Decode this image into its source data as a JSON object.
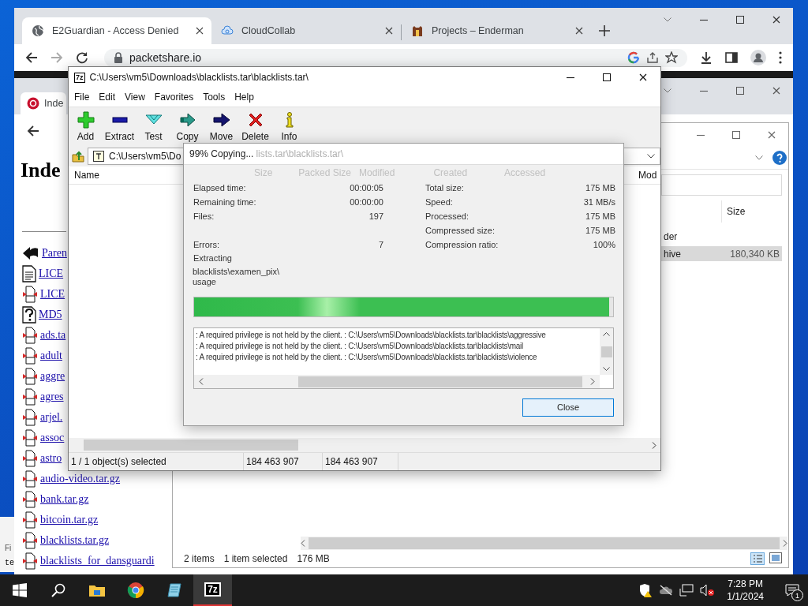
{
  "browser": {
    "tabs": [
      {
        "title": "E2Guardian - Access Denied",
        "selected": true
      },
      {
        "title": "CloudCollab",
        "selected": false
      },
      {
        "title": "Projects – Enderman",
        "selected": false
      }
    ],
    "url": "packetshare.io",
    "page": {
      "tab_title": "Inde",
      "heading": "Inde",
      "links": [
        {
          "text": "Paren",
          "kind": "back"
        },
        {
          "text": "LICE",
          "kind": "text"
        },
        {
          "text": "LICE",
          "kind": "archive"
        },
        {
          "text": "MD5",
          "kind": "unknown"
        },
        {
          "text": "ads.ta",
          "kind": "archive"
        },
        {
          "text": "adult",
          "kind": "archive"
        },
        {
          "text": "aggre",
          "kind": "archive"
        },
        {
          "text": "agres",
          "kind": "archive"
        },
        {
          "text": "arjel.",
          "kind": "archive"
        },
        {
          "text": "assoc",
          "kind": "archive"
        },
        {
          "text": "astro",
          "kind": "archive"
        },
        {
          "text": "audio-video.tar.gz",
          "kind": "archive"
        },
        {
          "text": "bank.tar.gz",
          "kind": "archive"
        },
        {
          "text": "bitcoin.tar.gz",
          "kind": "archive"
        },
        {
          "text": "blacklists.tar.gz",
          "kind": "archive"
        },
        {
          "text": "blacklists_for_dansguardi",
          "kind": "archive"
        }
      ]
    }
  },
  "explorer": {
    "column": "Size",
    "rows": [
      {
        "name": "der",
        "selected": false
      },
      {
        "name": "hive",
        "size": "180,340 KB",
        "selected": true
      }
    ],
    "status": {
      "items": "2 items",
      "selected": "1 item selected",
      "size": "176 MB"
    }
  },
  "sevenzip": {
    "logo": "7z",
    "title": "C:\\Users\\vm5\\Downloads\\blacklists.tar\\blacklists.tar\\",
    "menu": [
      "File",
      "Edit",
      "View",
      "Favorites",
      "Tools",
      "Help"
    ],
    "toolbar": [
      {
        "label": "Add",
        "kind": "add"
      },
      {
        "label": "Extract",
        "kind": "extract"
      },
      {
        "label": "Test",
        "kind": "test"
      },
      {
        "label": "Copy",
        "kind": "copy"
      },
      {
        "label": "Move",
        "kind": "move"
      },
      {
        "label": "Delete",
        "kind": "delete"
      },
      {
        "label": "Info",
        "kind": "info"
      }
    ],
    "path": "C:\\Users\\vm5\\Do",
    "columns": [
      "Name",
      "Mod"
    ],
    "status": [
      "1 / 1 object(s) selected",
      "184 463 907",
      "184 463 907"
    ]
  },
  "progress": {
    "title": "99% Copying...",
    "title_behind": "lists.tar\\blacklists.tar\\",
    "columns_behind": [
      "Size",
      "Packed Size",
      "Modified",
      "Created",
      "Accessed"
    ],
    "stats_left": [
      {
        "label": "Elapsed time:",
        "value": "00:00:05"
      },
      {
        "label": "Remaining time:",
        "value": "00:00:00"
      },
      {
        "label": "Files:",
        "value": "197"
      },
      {
        "label": "Errors:",
        "value": "7"
      }
    ],
    "stats_right": [
      {
        "label": "Total size:",
        "value": "175 MB"
      },
      {
        "label": "Speed:",
        "value": "31 MB/s"
      },
      {
        "label": "Processed:",
        "value": "175 MB"
      },
      {
        "label": "Compressed size:",
        "value": "175 MB"
      },
      {
        "label": "Compression ratio:",
        "value": "100%"
      }
    ],
    "operation": "Extracting",
    "current_file": "blacklists\\examen_pix\\usage",
    "level": 0.99,
    "log": [
      ": A required privilege is not held by the client. : C:\\Users\\vm5\\Downloads\\blacklists.tar\\blacklists\\aggressive",
      ": A required privilege is not held by the client. : C:\\Users\\vm5\\Downloads\\blacklists.tar\\blacklists\\mail",
      ": A required privilege is not held by the client. : C:\\Users\\vm5\\Downloads\\blacklists.tar\\blacklists\\violence"
    ],
    "button": "Close"
  },
  "taskbar": {
    "logo": "7z",
    "time": "7:28 PM",
    "date": "1/1/2024",
    "notifications": "1"
  },
  "fragment": [
    "Fi",
    "te"
  ]
}
